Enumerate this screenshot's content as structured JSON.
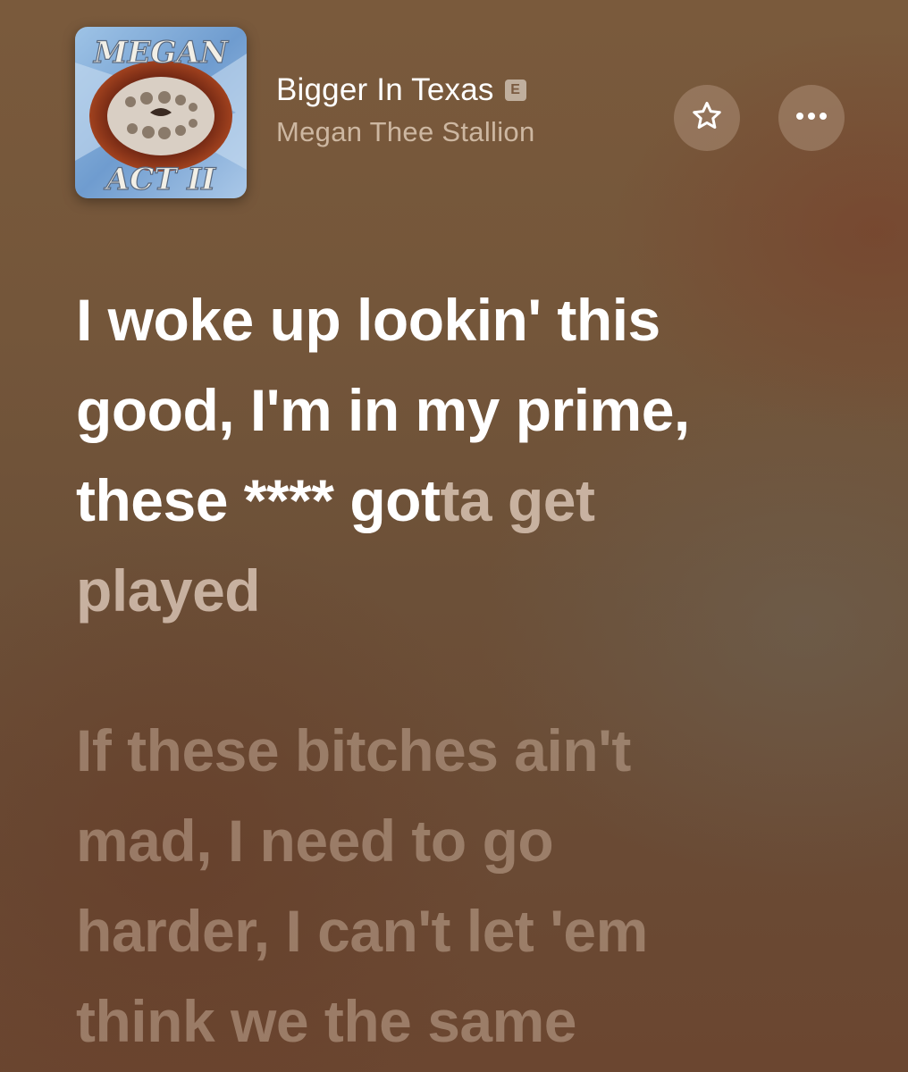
{
  "track": {
    "title": "Bigger In Texas",
    "explicit_badge": "E",
    "artist": "Megan Thee Stallion",
    "album_art_text_top": "MEGAN",
    "album_art_text_bottom": "ACT II"
  },
  "buttons": {
    "favorite_icon": "star-icon",
    "more_icon": "ellipsis-icon"
  },
  "lyrics": {
    "current": {
      "line1": "I woke up lookin' this",
      "line2": "good, I'm in my prime,",
      "line3_sung": "these **** got",
      "line3_unsung": "ta get",
      "line4": "played"
    },
    "next": {
      "line1": "If these bitches ain't",
      "line2": "mad, I need to go",
      "line3": "harder, I can't let 'em",
      "line4": "think we the same"
    }
  }
}
